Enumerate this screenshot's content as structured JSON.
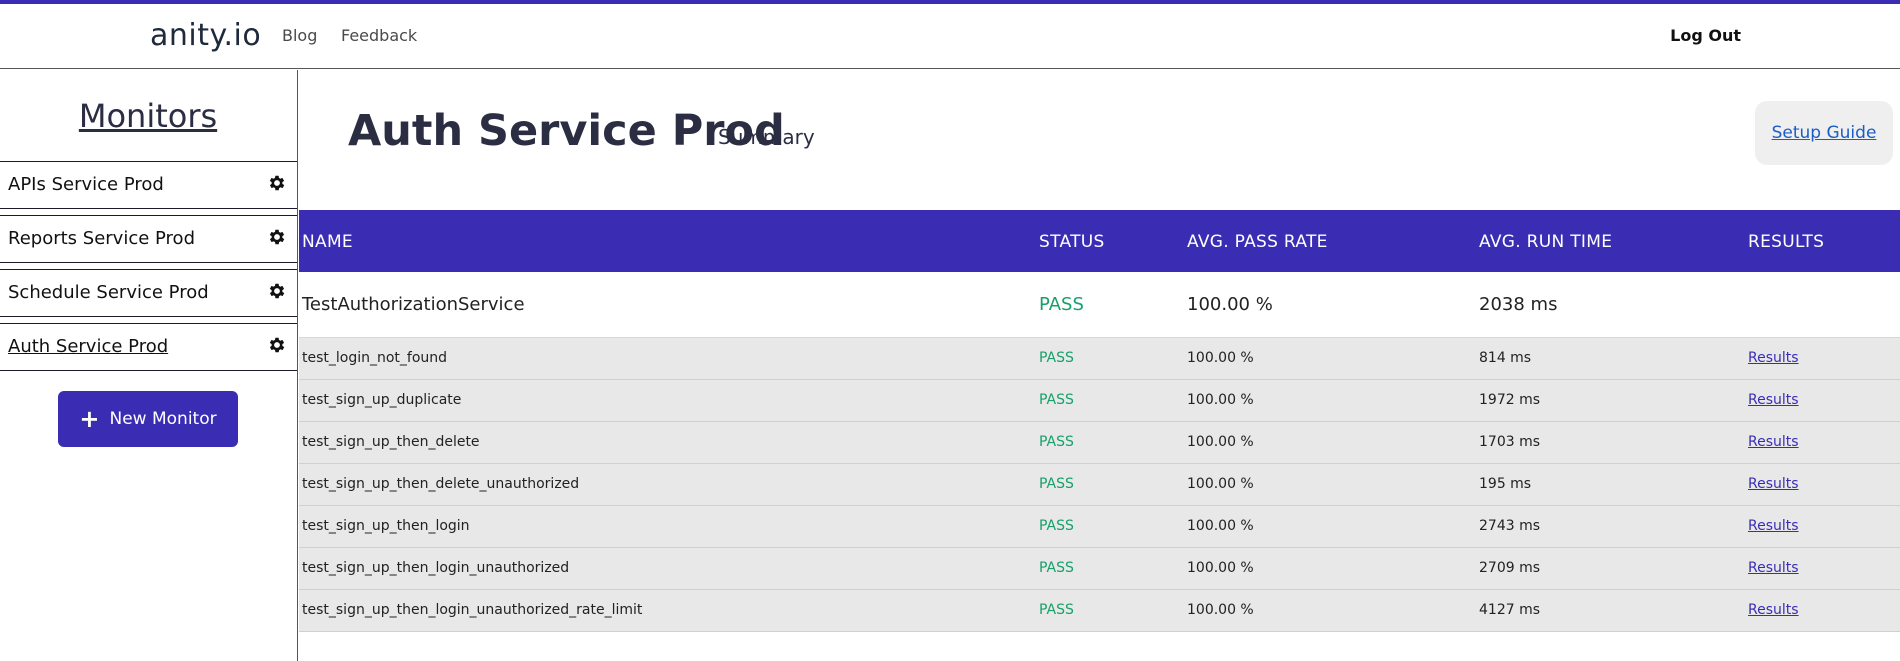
{
  "nav": {
    "logo": "anity.io",
    "blog": "Blog",
    "feedback": "Feedback",
    "logout": "Log Out"
  },
  "sidebar": {
    "title": "Monitors",
    "items": [
      {
        "label": "APIs Service Prod"
      },
      {
        "label": "Reports Service Prod"
      },
      {
        "label": "Schedule Service Prod"
      },
      {
        "label": "Auth Service Prod"
      }
    ],
    "new_monitor": "New Monitor"
  },
  "main": {
    "title": "Auth Service Prod",
    "subtitle": "Summary",
    "setup_guide": "Setup Guide"
  },
  "table": {
    "headers": {
      "name": "NAME",
      "status": "STATUS",
      "rate": "AVG. PASS RATE",
      "time": "AVG. RUN TIME",
      "results": "RESULTS"
    },
    "suite": {
      "name": "TestAuthorizationService",
      "status": "PASS",
      "rate": "100.00 %",
      "time": "2038 ms"
    },
    "rows": [
      {
        "name": "test_login_not_found",
        "status": "PASS",
        "rate": "100.00 %",
        "time": "814 ms",
        "results": "Results"
      },
      {
        "name": "test_sign_up_duplicate",
        "status": "PASS",
        "rate": "100.00 %",
        "time": "1972 ms",
        "results": "Results"
      },
      {
        "name": "test_sign_up_then_delete",
        "status": "PASS",
        "rate": "100.00 %",
        "time": "1703 ms",
        "results": "Results"
      },
      {
        "name": "test_sign_up_then_delete_unauthorized",
        "status": "PASS",
        "rate": "100.00 %",
        "time": "195 ms",
        "results": "Results"
      },
      {
        "name": "test_sign_up_then_login",
        "status": "PASS",
        "rate": "100.00 %",
        "time": "2743 ms",
        "results": "Results"
      },
      {
        "name": "test_sign_up_then_login_unauthorized",
        "status": "PASS",
        "rate": "100.00 %",
        "time": "2709 ms",
        "results": "Results"
      },
      {
        "name": "test_sign_up_then_login_unauthorized_rate_limit",
        "status": "PASS",
        "rate": "100.00 %",
        "time": "4127 ms",
        "results": "Results"
      }
    ]
  },
  "colors": {
    "accent": "#3a2db4",
    "pass": "#16a06a",
    "link": "#1a5dc4"
  },
  "icons": {
    "settings": "gear-icon",
    "add": "plus-icon"
  }
}
